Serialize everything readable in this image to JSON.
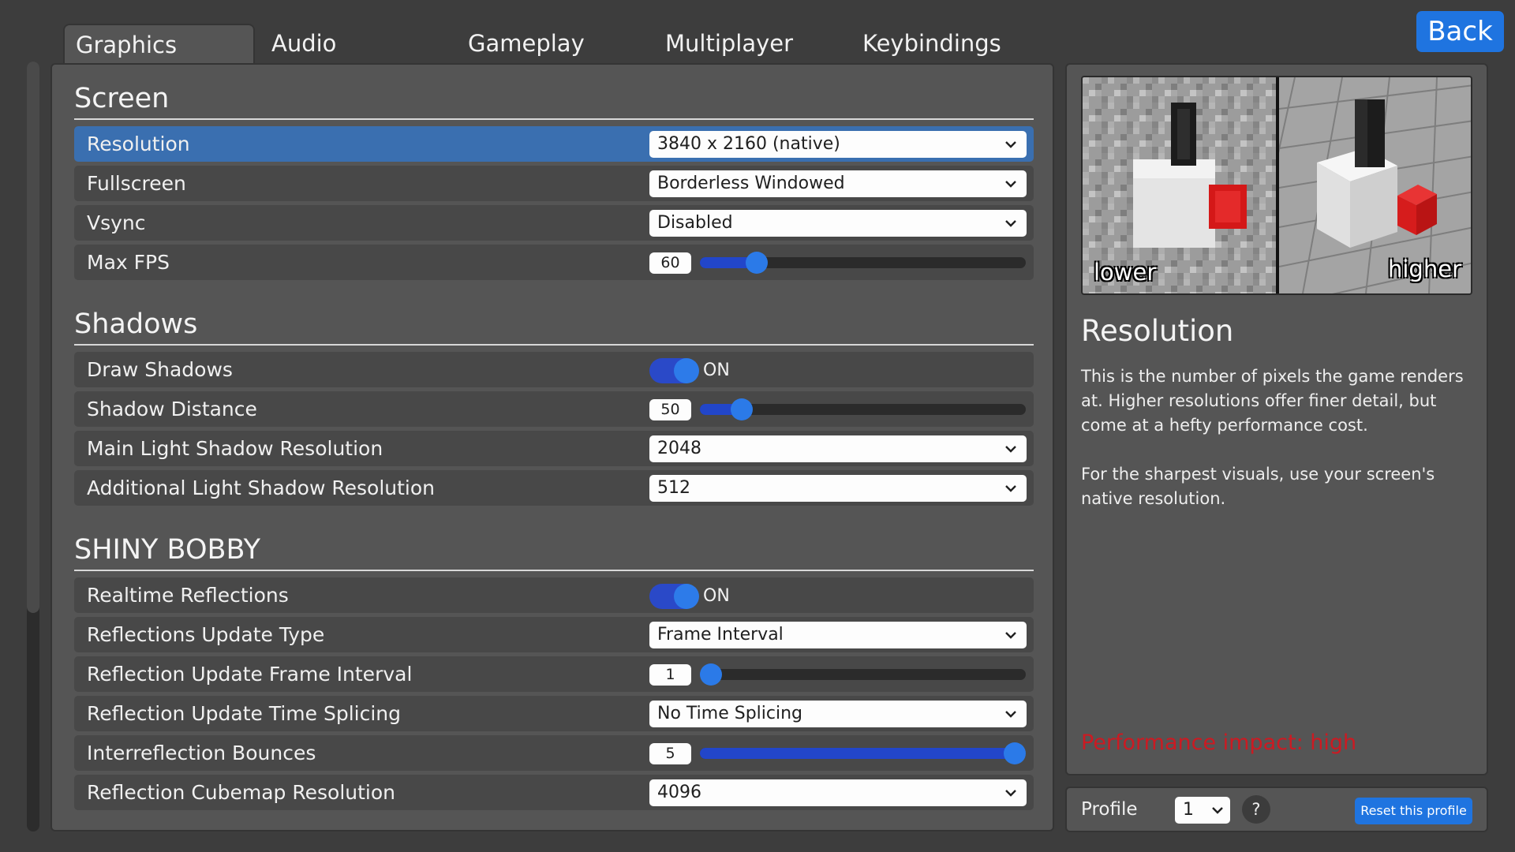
{
  "tabs": [
    {
      "label": "Graphics",
      "active": true
    },
    {
      "label": "Audio",
      "active": false
    },
    {
      "label": "Gameplay",
      "active": false
    },
    {
      "label": "Multiplayer",
      "active": false
    },
    {
      "label": "Keybindings",
      "active": false
    }
  ],
  "back_label": "Back",
  "sections": {
    "screen": {
      "title": "Screen",
      "resolution": {
        "label": "Resolution",
        "value": "3840 x 2160 (native)"
      },
      "fullscreen": {
        "label": "Fullscreen",
        "value": "Borderless Windowed"
      },
      "vsync": {
        "label": "Vsync",
        "value": "Disabled"
      },
      "max_fps": {
        "label": "Max FPS",
        "value": "60",
        "fill_fraction": 0.15
      }
    },
    "shadows": {
      "title": "Shadows",
      "draw_shadows": {
        "label": "Draw Shadows",
        "state": "ON"
      },
      "shadow_distance": {
        "label": "Shadow Distance",
        "value": "50",
        "fill_fraction": 0.1
      },
      "main_light_res": {
        "label": "Main Light Shadow Resolution",
        "value": "2048"
      },
      "additional_light_res": {
        "label": "Additional Light Shadow Resolution",
        "value": "512"
      }
    },
    "shiny_bobby": {
      "title": "SHINY BOBBY",
      "realtime_reflections": {
        "label": "Realtime Reflections",
        "state": "ON"
      },
      "update_type": {
        "label": "Reflections Update Type",
        "value": "Frame Interval"
      },
      "frame_interval": {
        "label": "Reflection Update Frame Interval",
        "value": "1",
        "fill_fraction": 0.0
      },
      "time_splicing": {
        "label": "Reflection Update Time Splicing",
        "value": "No Time Splicing"
      },
      "interreflection": {
        "label": "Interreflection Bounces",
        "value": "5",
        "fill_fraction": 1.0
      },
      "cubemap_res": {
        "label": "Reflection Cubemap Resolution",
        "value": "4096"
      }
    }
  },
  "info": {
    "preview_lower": "lower",
    "preview_higher": "higher",
    "title": "Resolution",
    "paragraph1": "This is the number of pixels the game renders at. Higher resolutions offer finer detail, but come at a hefty performance cost.",
    "paragraph2": "For the sharpest visuals, use your screen's native resolution.",
    "performance_impact": "Performance impact: high"
  },
  "profile": {
    "label": "Profile",
    "value": "1",
    "help": "?",
    "reset_label": "Reset this profile"
  },
  "colors": {
    "accent": "#1f74e0",
    "row_highlight": "#3a6fb0",
    "perf_high": "#cc1a22"
  }
}
